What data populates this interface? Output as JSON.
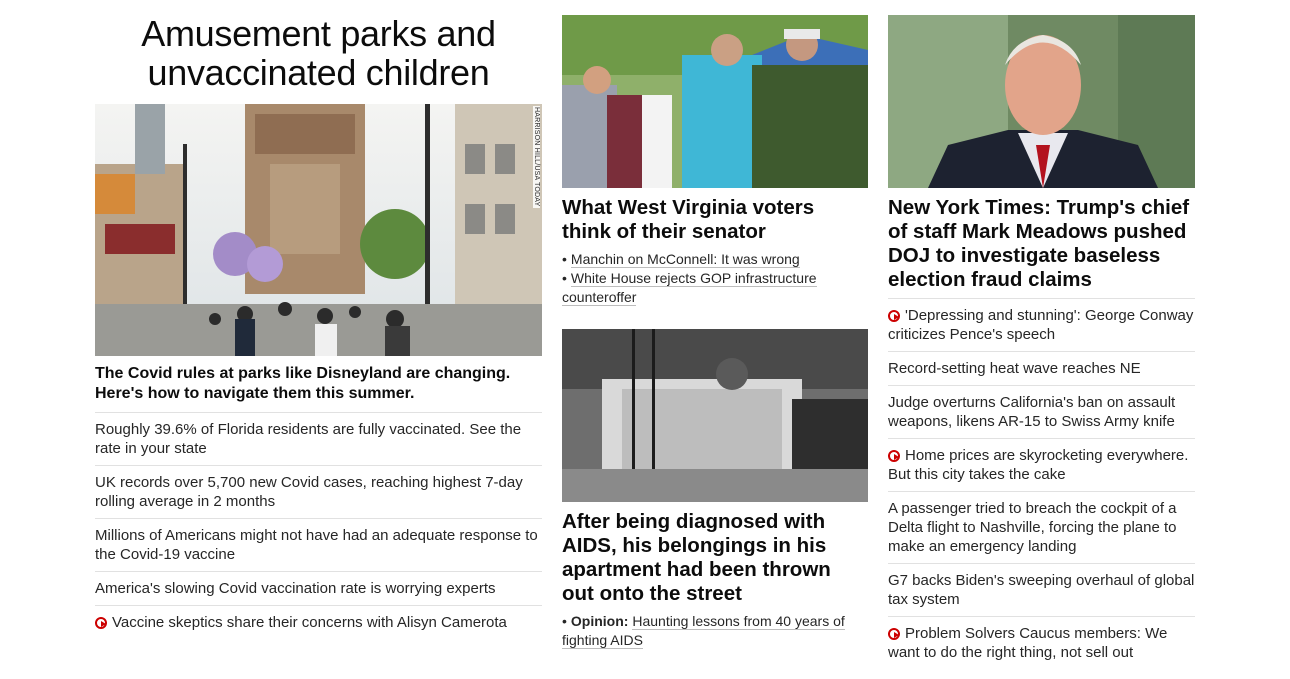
{
  "col1": {
    "banner_line1": "Amusement parks and",
    "banner_line2": "unvaccinated children",
    "photo_credit": "HARRISON HILL/USA TODAY",
    "headline": "The Covid rules at parks like Disneyland are changing. Here's how to navigate them this summer.",
    "links": [
      {
        "text": "Roughly 39.6% of Florida residents are fully vaccinated. See the rate in your state",
        "video": false
      },
      {
        "text": "UK records over 5,700 new Covid cases, reaching highest 7-day rolling average in 2 months",
        "video": false
      },
      {
        "text": "Millions of Americans might not have had an adequate response to the Covid-19 vaccine",
        "video": false
      },
      {
        "text": "America's slowing Covid vaccination rate is worrying experts",
        "video": false
      },
      {
        "text": "Vaccine skeptics share their concerns with Alisyn Camerota",
        "video": true
      }
    ]
  },
  "col2": {
    "story1": {
      "headline": "What West Virginia voters think of their senator",
      "sub1": "Manchin on McConnell: It was wrong",
      "sub2": "White House rejects GOP infrastructure counteroffer"
    },
    "story2": {
      "headline": "After being diagnosed with AIDS, his belongings in his apartment had been thrown out onto the street",
      "sub_label": "Opinion:",
      "sub_text": "Haunting lessons from 40 years of fighting AIDS"
    }
  },
  "col3": {
    "headline": "New York Times: Trump's chief of staff Mark Meadows pushed DOJ to investigate baseless election fraud claims",
    "links": [
      {
        "text": "'Depressing and stunning': George Conway criticizes Pence's speech",
        "video": true
      },
      {
        "text": "Record-setting heat wave reaches NE",
        "video": false
      },
      {
        "text": "Judge overturns California's ban on assault weapons, likens AR-15 to Swiss Army knife",
        "video": false
      },
      {
        "text": "Home prices are skyrocketing everywhere. But this city takes the cake",
        "video": true
      },
      {
        "text": "A passenger tried to breach the cockpit of a Delta flight to Nashville, forcing the plane to make an emergency landing",
        "video": false
      },
      {
        "text": "G7 backs Biden's sweeping overhaul of global tax system",
        "video": false
      },
      {
        "text": "Problem Solvers Caucus members: We want to do the right thing, not sell out",
        "video": true
      }
    ]
  },
  "colors": {
    "video_icon": "#cc0000",
    "divider": "#e1e1e1",
    "text": "#0c0c0c"
  }
}
